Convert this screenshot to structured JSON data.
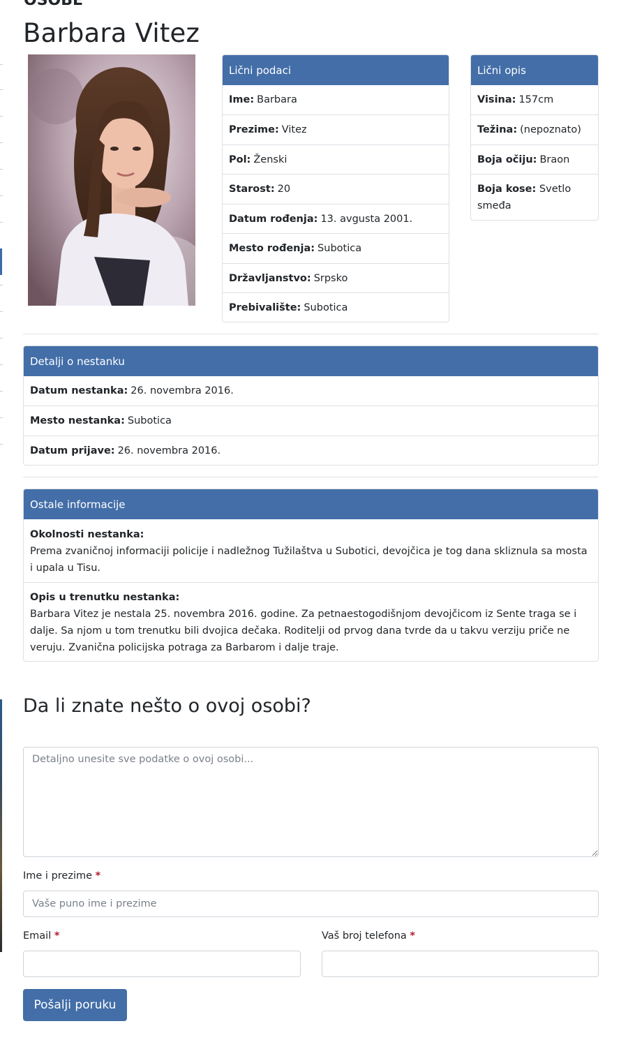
{
  "page": {
    "title_top_cut": "OSOBE",
    "person_name": "Barbara Vitez"
  },
  "personal": {
    "header": "Lični podaci",
    "rows": [
      {
        "label": "Ime:",
        "value": "Barbara"
      },
      {
        "label": "Prezime:",
        "value": "Vitez"
      },
      {
        "label": "Pol:",
        "value": "Ženski"
      },
      {
        "label": "Starost:",
        "value": "20"
      },
      {
        "label": "Datum rođenja:",
        "value": "13. avgusta 2001."
      },
      {
        "label": "Mesto rođenja:",
        "value": "Subotica"
      },
      {
        "label": "Državljanstvo:",
        "value": "Srpsko"
      },
      {
        "label": "Prebivalište:",
        "value": "Subotica"
      }
    ]
  },
  "description": {
    "header": "Lični opis",
    "rows": [
      {
        "label": "Visina:",
        "value": "157cm"
      },
      {
        "label": "Težina:",
        "value": "(nepoznato)"
      },
      {
        "label": "Boja očiju:",
        "value": "Braon"
      },
      {
        "label": "Boja kose:",
        "value": "Svetlo smeđa"
      }
    ]
  },
  "disappearance": {
    "header": "Detalji o nestanku",
    "rows": [
      {
        "label": "Datum nestanka:",
        "value": "26. novembra 2016."
      },
      {
        "label": "Mesto nestanka:",
        "value": "Subotica"
      },
      {
        "label": "Datum prijave:",
        "value": "26. novembra 2016."
      }
    ]
  },
  "other": {
    "header": "Ostale informacije",
    "circumstances_label": "Okolnosti nestanka:",
    "circumstances_text": "Prema zvaničnoj informaciji policije i nadležnog Tužilaštva u Subotici, devojčica je tog dana skliznula sa mosta i upala u Tisu.",
    "description_label": "Opis u trenutku nestanka:",
    "description_text": "Barbara Vitez je nestala 25. novembra 2016. godine. Za petnaestogodišnjom devojčicom iz Sente traga se i dalje. Sa njom u tom trenutku bili dvojica dečaka. Roditelji od prvog dana tvrde da u takvu verziju priče ne veruju. Zvanična policijska potraga za Barbarom i dalje traje."
  },
  "form": {
    "heading": "Da li znate nešto o ovoj osobi?",
    "message_placeholder": "Detaljno unesite sve podatke o ovoj osobi...",
    "name_label": "Ime i prezime",
    "name_placeholder": "Vaše puno ime i prezime",
    "email_label": "Email",
    "phone_label": "Vaš broj telefona",
    "required_mark": "*",
    "submit_label": "Pošalji poruku"
  },
  "colors": {
    "accent": "#436ea8",
    "required": "#b01c2b"
  }
}
